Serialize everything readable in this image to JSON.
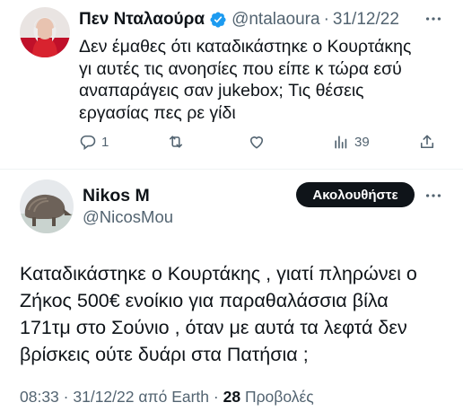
{
  "reply": {
    "author_name": "Πεν Νταλαούρα",
    "handle": "@ntalaoura",
    "separator": "·",
    "date": "31/12/22",
    "verified_icon": "verified-badge-icon",
    "text": "Δεν έμαθες ότι καταδικάστηκε ο Κουρτάκης\nγι αυτές τις ανοησίες που είπε κ τώρα εσύ\nαναπαράγεις σαν jukebox; Τις θέσεις\nεργασίας πες ρε γίδι",
    "actions": {
      "reply_count": "1",
      "retweet_count": "",
      "like_count": "",
      "views_count": "39"
    }
  },
  "tweet": {
    "author_name": "Nikos M",
    "handle": "@NicosMou",
    "follow_label": "Ακολουθήστε",
    "text": "Καταδικάστηκε ο Κουρτάκης , γιατί πληρώνει ο\nΖήκος 500€ ενοίκιο για παραθαλάσσια βίλα\n171τμ στο Σούνιο , όταν με αυτά τα λεφτά δεν\nβρίσκεις ούτε δυάρι στα Πατήσια ;",
    "time": "08:33",
    "date": "31/12/22",
    "source_prefix": "από",
    "source": "Earth",
    "views_count": "28",
    "views_label": "Προβολές"
  },
  "colors": {
    "text_primary": "#0f1419",
    "text_secondary": "#536471",
    "verified_blue": "#1d9bf0",
    "follow_bg": "#0f1419"
  }
}
